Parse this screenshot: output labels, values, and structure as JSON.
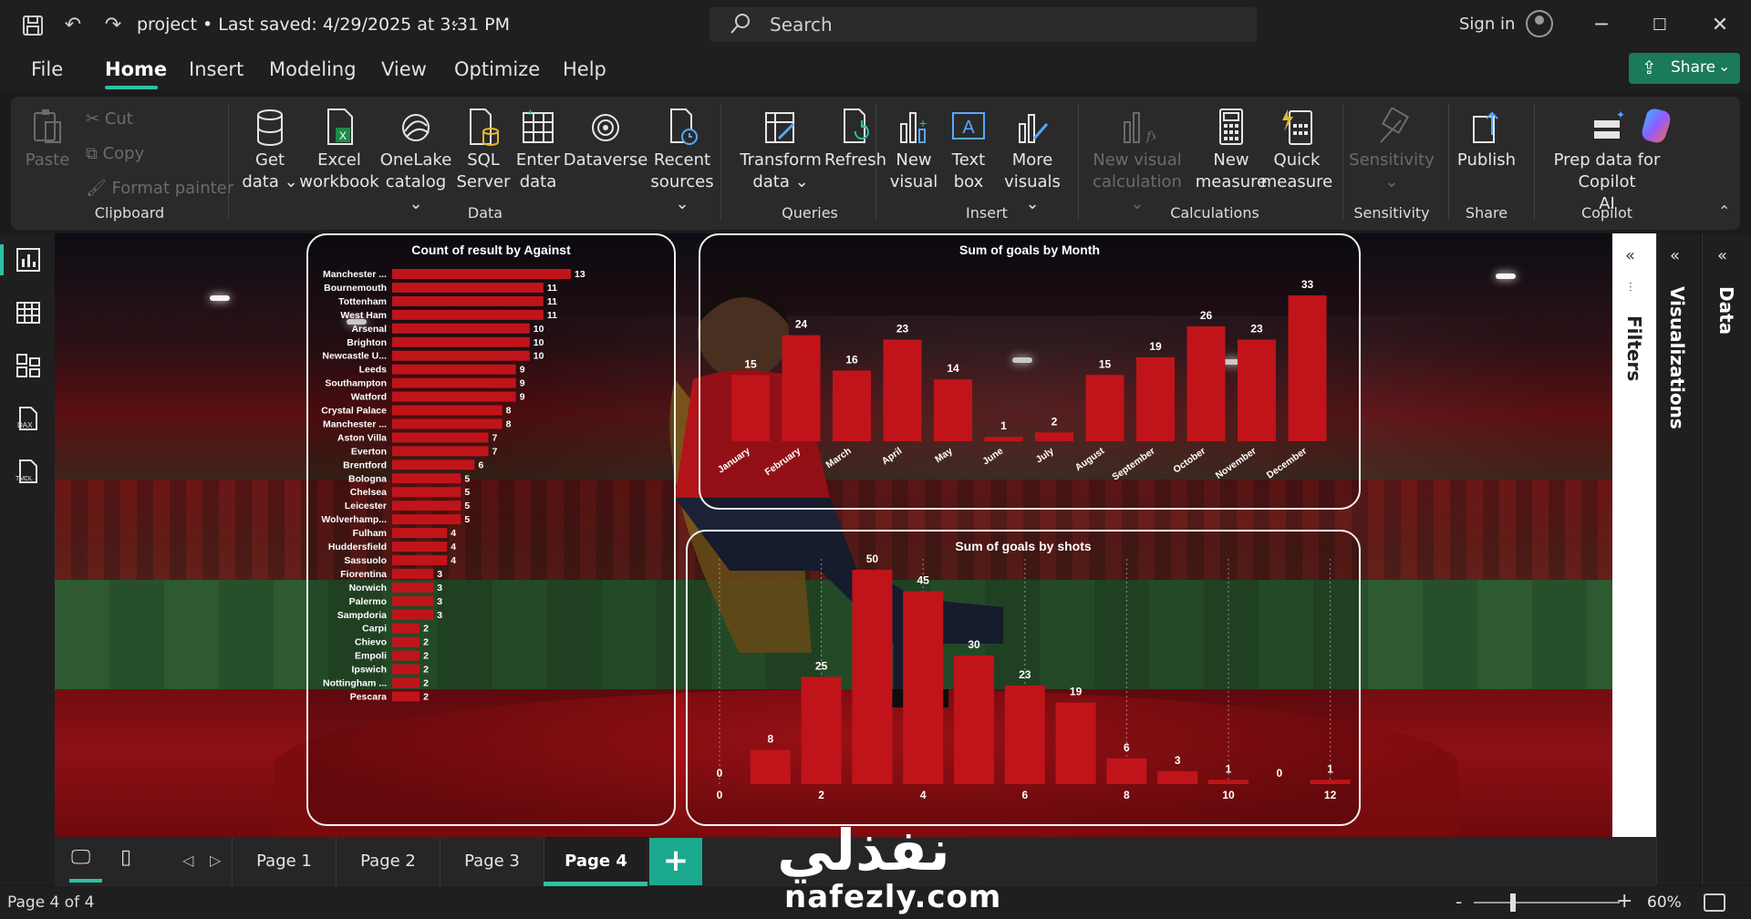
{
  "titlebar": {
    "title": "project • Last saved: 4/29/2025 at 3:31 PM",
    "search_placeholder": "Search",
    "sign_in": "Sign in"
  },
  "menu": {
    "items": [
      "File",
      "Home",
      "Insert",
      "Modeling",
      "View",
      "Optimize",
      "Help"
    ],
    "active": "Home",
    "share": "Share"
  },
  "ribbon": {
    "clipboard": {
      "paste": "Paste",
      "cut": "Cut",
      "copy": "Copy",
      "format_painter": "Format painter",
      "label": "Clipboard"
    },
    "data": {
      "get_data": [
        "Get",
        "data"
      ],
      "excel": [
        "Excel",
        "workbook"
      ],
      "onelake": [
        "OneLake",
        "catalog"
      ],
      "sql": [
        "SQL",
        "Server"
      ],
      "enter": [
        "Enter",
        "data"
      ],
      "dataverse": [
        "Dataverse",
        ""
      ],
      "recent": [
        "Recent",
        "sources"
      ],
      "label": "Data"
    },
    "queries": {
      "transform": [
        "Transform",
        "data"
      ],
      "refresh": [
        "Refresh",
        ""
      ],
      "label": "Queries"
    },
    "insert": {
      "new_visual": [
        "New",
        "visual"
      ],
      "text_box": [
        "Text",
        "box"
      ],
      "more_visuals": [
        "More",
        "visuals"
      ],
      "label": "Insert"
    },
    "calculations": {
      "new_visual_calc": [
        "New visual",
        "calculation"
      ],
      "new_measure": [
        "New",
        "measure"
      ],
      "quick_measure": [
        "Quick",
        "measure"
      ],
      "label": "Calculations"
    },
    "sensitivity": {
      "button": "Sensitivity",
      "label": "Sensitivity"
    },
    "share": {
      "publish": "Publish",
      "label": "Share"
    },
    "copilot": {
      "prep": [
        "Prep data for Copilot",
        "AI"
      ],
      "label": "Copilot"
    }
  },
  "panes": {
    "filters": "Filters",
    "visualizations": "Visualizations",
    "data": "Data"
  },
  "pages": {
    "tabs": [
      "Page 1",
      "Page 2",
      "Page 3",
      "Page 4"
    ],
    "active": "Page 4",
    "add": "+"
  },
  "status": {
    "page": "Page 4 of 4",
    "zoom": "60%",
    "zoom_fraction": 0.6
  },
  "watermark": {
    "arabic": "نفذلي",
    "latin": "nafezly.com"
  },
  "colors": {
    "accent": "#2ec0a6",
    "bar": "#c0141a",
    "share_btn": "#1b7a5a"
  },
  "chart_data": [
    {
      "type": "bar",
      "orientation": "horizontal",
      "title": "Count of result by Against",
      "categories": [
        "Manchester ...",
        "Bournemouth",
        "Tottenham",
        "West Ham",
        "Arsenal",
        "Brighton",
        "Newcastle U...",
        "Leeds",
        "Southampton",
        "Watford",
        "Crystal Palace",
        "Manchester ...",
        "Aston Villa",
        "Everton",
        "Brentford",
        "Bologna",
        "Chelsea",
        "Leicester",
        "Wolverhamp...",
        "Fulham",
        "Huddersfield",
        "Sassuolo",
        "Fiorentina",
        "Norwich",
        "Palermo",
        "Sampdoria",
        "Carpi",
        "Chievo",
        "Empoli",
        "Ipswich",
        "Nottingham ...",
        "Pescara"
      ],
      "values": [
        13,
        11,
        11,
        11,
        10,
        10,
        10,
        9,
        9,
        9,
        8,
        8,
        7,
        7,
        6,
        5,
        5,
        5,
        5,
        4,
        4,
        4,
        3,
        3,
        3,
        3,
        2,
        2,
        2,
        2,
        2,
        2
      ],
      "xlim": [
        0,
        13
      ]
    },
    {
      "type": "bar",
      "title": "Sum of goals by Month",
      "categories": [
        "January",
        "February",
        "March",
        "April",
        "May",
        "June",
        "July",
        "August",
        "September",
        "October",
        "November",
        "December"
      ],
      "values": [
        15,
        24,
        16,
        23,
        14,
        1,
        2,
        15,
        19,
        26,
        23,
        33
      ],
      "ylim": [
        0,
        33
      ]
    },
    {
      "type": "bar",
      "title": "Sum of goals by shots",
      "x": [
        0,
        1,
        2,
        3,
        4,
        5,
        6,
        7,
        8,
        9,
        10,
        11,
        12
      ],
      "values": [
        0,
        8,
        25,
        50,
        45,
        30,
        23,
        19,
        6,
        3,
        1,
        0,
        1
      ],
      "xticks": [
        "0",
        "2",
        "4",
        "6",
        "8",
        "10",
        "12"
      ],
      "ylim": [
        0,
        50
      ]
    }
  ]
}
